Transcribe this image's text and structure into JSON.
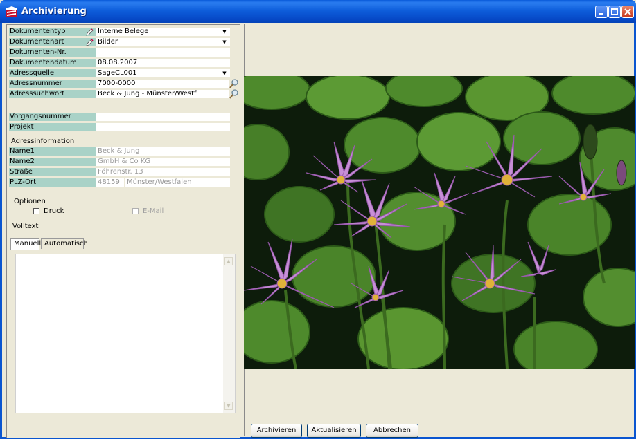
{
  "window": {
    "title": "Archivierung"
  },
  "fields": {
    "dokumententyp": {
      "label": "Dokumententyp",
      "value": "Interne Belege"
    },
    "dokumentenart": {
      "label": "Dokumentenart",
      "value": "Bilder"
    },
    "dokumenten_nr": {
      "label": "Dokumenten-Nr.",
      "value": ""
    },
    "dokumentendatum": {
      "label": "Dokumentendatum",
      "value": "08.08.2007"
    },
    "adressquelle": {
      "label": "Adressquelle",
      "value": "SageCL001"
    },
    "adressnummer": {
      "label": "Adressnummer",
      "value": "7000-0000"
    },
    "adresssuchwort": {
      "label": "Adresssuchwort",
      "value": "Beck & Jung - Münster/Westf"
    },
    "vorgangsnummer": {
      "label": "Vorgangsnummer",
      "value": ""
    },
    "projekt": {
      "label": "Projekt",
      "value": ""
    }
  },
  "adressinformation": {
    "heading": "Adressinformation",
    "name1": {
      "label": "Name1",
      "value": "Beck & Jung"
    },
    "name2": {
      "label": "Name2",
      "value": "GmbH & Co KG"
    },
    "strasse": {
      "label": "Straße",
      "value": "Föhrenstr. 13"
    },
    "plz_ort": {
      "label": "PLZ-Ort",
      "plz": "48159",
      "ort": "Münster/Westfalen"
    }
  },
  "optionen": {
    "heading": "Optionen",
    "druck": {
      "label": "Druck",
      "checked": false
    },
    "email": {
      "label": "E-Mail",
      "checked": false,
      "enabled": false
    }
  },
  "volltext": {
    "heading": "Volltext",
    "tabs": [
      {
        "label": "Manuell",
        "active": true
      },
      {
        "label": "Automatisch",
        "active": false
      }
    ],
    "text": ""
  },
  "buttons": {
    "archivieren": "Archivieren",
    "aktualisieren": "Aktualisieren",
    "abbrechen": "Abbrechen"
  },
  "preview": {
    "image": "water-lily-photo"
  },
  "colors": {
    "title_bar": "#0A5BDA",
    "label_bg": "#A9D2C7",
    "window_bg": "#ECE9D8"
  }
}
